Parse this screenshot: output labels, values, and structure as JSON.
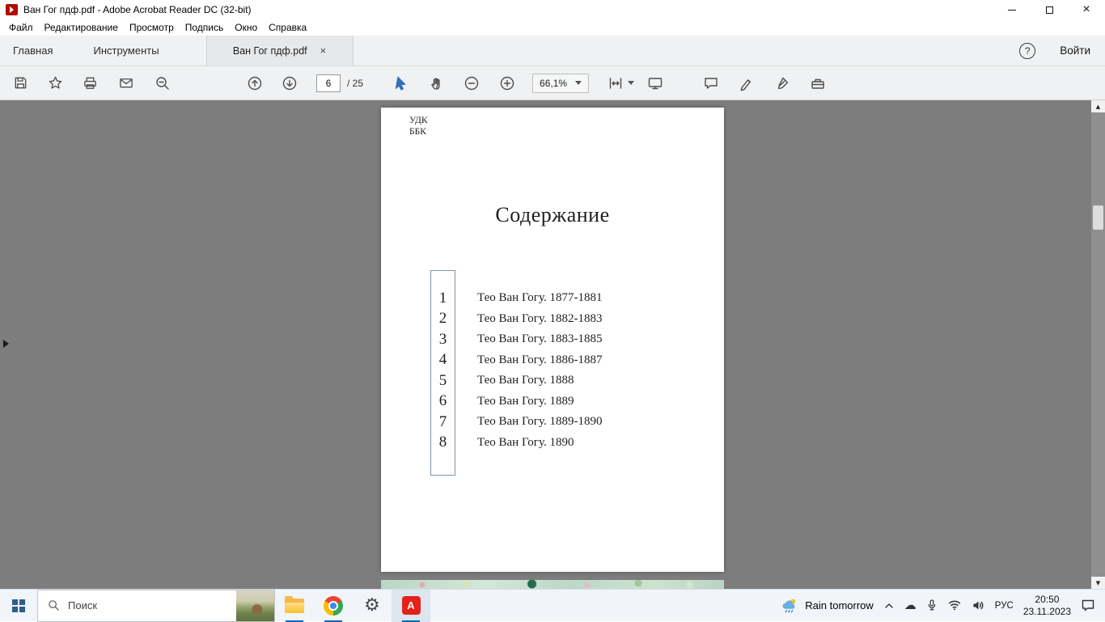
{
  "titlebar": {
    "title": "Ван Гог пдф.pdf - Adobe Acrobat Reader DC (32-bit)"
  },
  "menubar": {
    "items": [
      "Файл",
      "Редактирование",
      "Просмотр",
      "Подпись",
      "Окно",
      "Справка"
    ]
  },
  "tabbar": {
    "home": "Главная",
    "tools": "Инструменты",
    "document_tab": "Ван Гог пдф.pdf",
    "signin": "Войти"
  },
  "toolbar": {
    "page_current": "6",
    "page_total": "/ 25",
    "zoom_level": "66,1%"
  },
  "page": {
    "udk": "УДК",
    "bbk": "ББК",
    "title": "Содержание",
    "toc": [
      {
        "num": "1",
        "label": "Тео Ван Гогу. 1877-1881"
      },
      {
        "num": "2",
        "label": "Тео Ван Гогу. 1882-1883"
      },
      {
        "num": "3",
        "label": "Тео Ван Гогу. 1883-1885"
      },
      {
        "num": "4",
        "label": "Тео Ван Гогу. 1886-1887"
      },
      {
        "num": "5",
        "label": "Тео Ван Гогу. 1888"
      },
      {
        "num": "6",
        "label": "Тео Ван Гогу. 1889"
      },
      {
        "num": "7",
        "label": "Тео Ван Гогу. 1889-1890"
      },
      {
        "num": "8",
        "label": "Тео Ван Гогу. 1890"
      }
    ]
  },
  "taskbar": {
    "search_placeholder": "Поиск",
    "weather": "Rain tomorrow",
    "language": "РУС",
    "time": "20:50",
    "date": "23.11.2023"
  },
  "icons": {
    "tab_close": "×",
    "window_close": "×",
    "help": "?",
    "scroll_up": "▲",
    "scroll_down": "▼",
    "gear": "⚙",
    "cloud": "☁",
    "acrobat_logo": "A"
  },
  "colors": {
    "accent": "#0067c0",
    "acrobat_red": "#e2231a",
    "doc_background": "#7d7d7d"
  }
}
